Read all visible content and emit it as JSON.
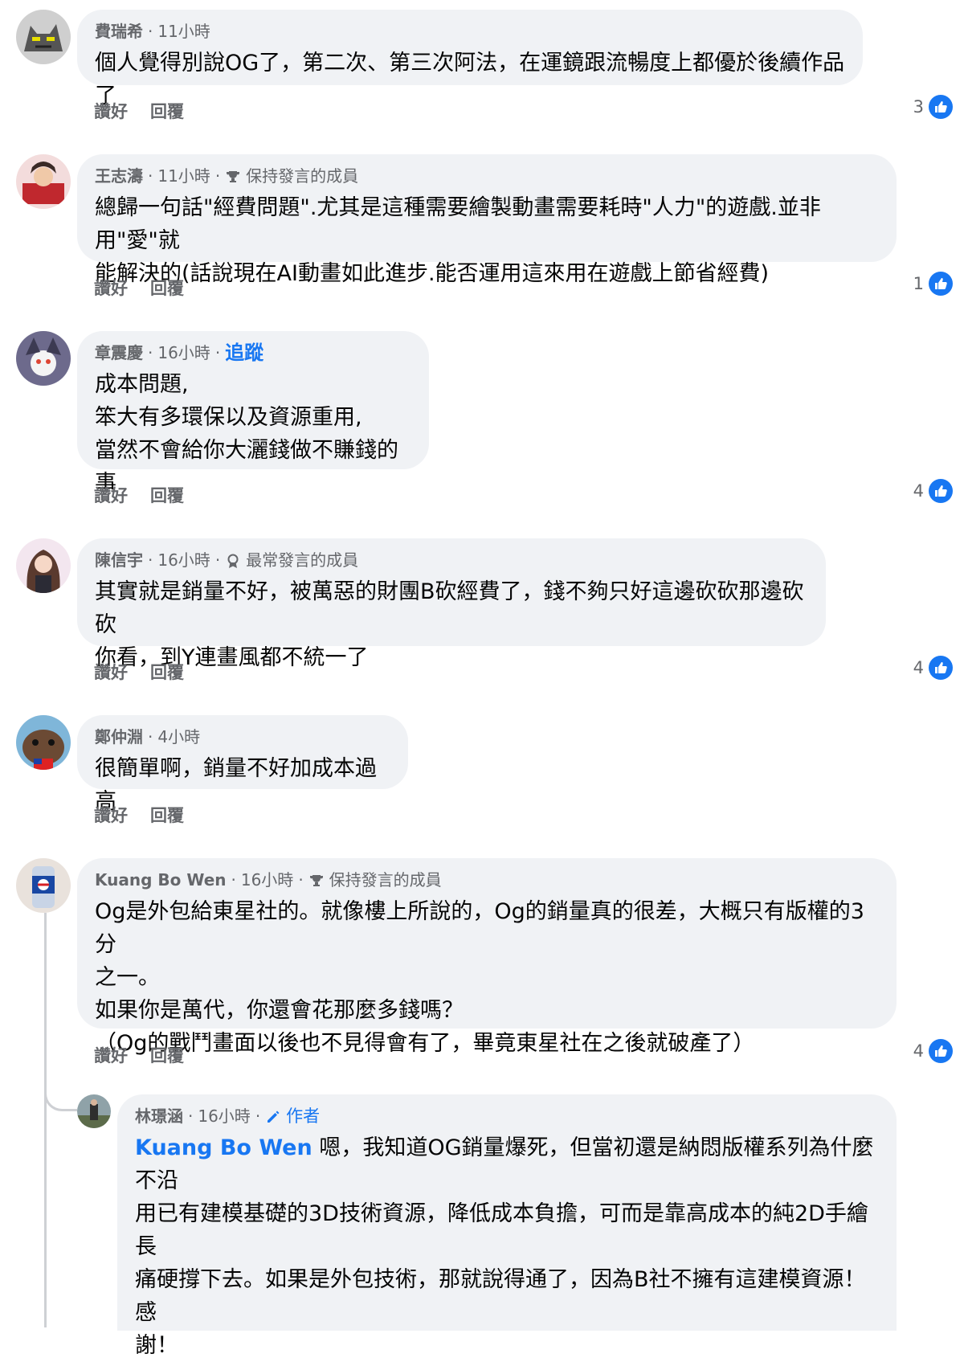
{
  "comments": [
    {
      "name": "費瑞希",
      "time": "11小時",
      "badge": "",
      "text": "個人覺得別說OG了，第二次、第三次阿法，在運鏡跟流暢度上都優於後續作品了",
      "like_label": "讚好",
      "reply_label": "回覆",
      "reactions": "3"
    },
    {
      "name": "王志濤",
      "time": "11小時",
      "badge": "保持發言的成員",
      "text": "總歸一句話\"經費問題\".尤其是這種需要繪製動畫需要耗時\"人力\"的遊戲.並非用\"愛\"就\n能解決的(話說現在AI動畫如此進步.能否運用這來用在遊戲上節省經費)",
      "like_label": "讚好",
      "reply_label": "回覆",
      "reactions": "1"
    },
    {
      "name": "章震慶",
      "time": "16小時",
      "follow": "追蹤",
      "text": "成本問題,\n笨大有多環保以及資源重用,\n當然不會給你大灑錢做不賺錢的事",
      "like_label": "讚好",
      "reply_label": "回覆",
      "reactions": "4"
    },
    {
      "name": "陳信宇",
      "time": "16小時",
      "badge": "最常發言的成員",
      "text": "其實就是銷量不好，被萬惡的財團B砍經費了，錢不夠只好這邊砍砍那邊砍砍\n你看，到Y連畫風都不統一了",
      "like_label": "讚好",
      "reply_label": "回覆",
      "reactions": "4"
    },
    {
      "name": "鄭仲淵",
      "time": "4小時",
      "text": "很簡單啊，銷量不好加成本過高",
      "like_label": "讚好",
      "reply_label": "回覆",
      "reactions": ""
    },
    {
      "name": "Kuang Bo Wen",
      "time": "16小時",
      "badge": "保持發言的成員",
      "text": "Og是外包給東星社的。就像樓上所說的，Og的銷量真的很差，大概只有版權的3分\n之一。\n如果你是萬代，你還會花那麼多錢嗎？\n（Og的戰鬥畫面以後也不見得會有了，畢竟東星社在之後就破產了）",
      "like_label": "讚好",
      "reply_label": "回覆",
      "reactions": "4"
    }
  ],
  "reply": {
    "name": "林璟涵",
    "time": "16小時",
    "badge": "作者",
    "mention": "Kuang Bo Wen",
    "text": " 嗯，我知道OG銷量爆死，但當初還是納悶版權系列為什麼不沿\n用已有建模基礎的3D技術資源，降低成本負擔，可而是靠高成本的純2D手繪長\n痛硬撐下去。如果是外包技術，那就說得通了，因為B社不擁有這建模資源！感\n謝！"
  },
  "icons": {
    "like": "like-thumb-icon",
    "trophy": "trophy-icon",
    "award": "award-ribbon-icon",
    "pencil": "pencil-icon"
  },
  "colors": {
    "bubble": "#f0f2f5",
    "accent": "#1877f2",
    "muted": "#65676b"
  }
}
